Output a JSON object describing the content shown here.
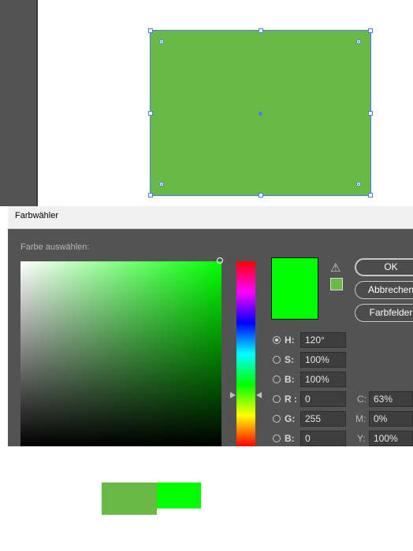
{
  "colors": {
    "shape_fill": "#69b946",
    "new_color": "#00ff00",
    "hue_color": "#00ff00",
    "selection_blue": "#4a7cf0",
    "panel_bg": "#535353"
  },
  "icons": {
    "gamut_warning": "warning-triangle-icon"
  },
  "dialog": {
    "title": "Farbwähler",
    "select_label": "Farbe auswählen:",
    "buttons": {
      "ok": "OK",
      "cancel": "Abbrechen",
      "swatches": "Farbfelder"
    },
    "fields": {
      "h": {
        "label": "H:",
        "value": "120°",
        "checked": true
      },
      "s": {
        "label": "S:",
        "value": "100%",
        "checked": false
      },
      "b": {
        "label": "B:",
        "value": "100%",
        "checked": false
      },
      "r": {
        "label": "R :",
        "value": "0",
        "checked": false
      },
      "g": {
        "label": "G:",
        "value": "255",
        "checked": false
      },
      "b2": {
        "label": "B:",
        "value": "0",
        "checked": false
      }
    },
    "cmyk": {
      "c": {
        "label": "C:",
        "value": "63%"
      },
      "m": {
        "label": "M:",
        "value": "0%"
      },
      "y": {
        "label": "Y:",
        "value": "100%"
      }
    }
  }
}
